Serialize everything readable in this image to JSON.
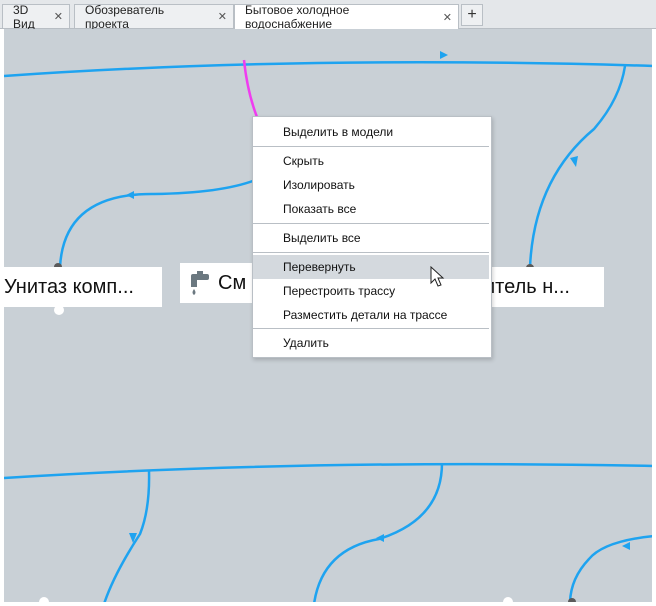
{
  "tabs": [
    {
      "label": "3D Вид",
      "close": "✕"
    },
    {
      "label": "Обозреватель проекта",
      "close": "✕"
    },
    {
      "label": "Бытовое холодное водоснабжение",
      "close": "✕"
    }
  ],
  "tab_add": "+",
  "nodes": {
    "left": "Унитаз комп...",
    "middle": "См",
    "right": "итель н..."
  },
  "context_menu": {
    "items": [
      "Выделить в модели",
      "Скрыть",
      "Изолировать",
      "Показать все",
      "Выделить все",
      "Перевернуть",
      "Перестроить трассу",
      "Разместить детали на трассе",
      "Удалить"
    ],
    "highlighted": "Перевернуть"
  },
  "colors": {
    "pipe": "#1ea3f0",
    "selected_pipe": "#f03cf0",
    "background": "#c9d0d6",
    "menu_highlight": "#d4d9de",
    "port": "#5a5a5a"
  },
  "icons": {
    "faucet": "faucet-icon",
    "cursor": "mouse-cursor-icon"
  }
}
